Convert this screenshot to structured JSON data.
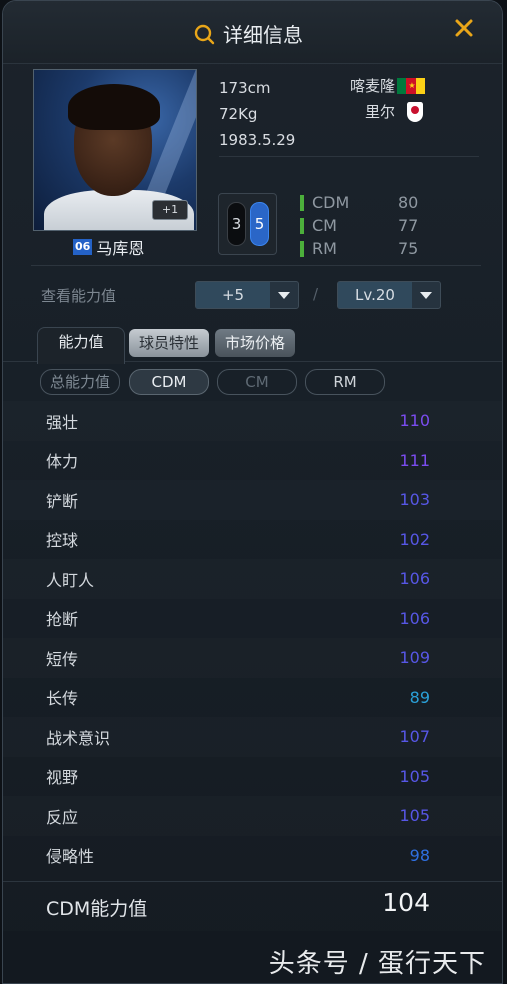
{
  "header": {
    "title": "详细信息",
    "search_icon": "search-icon",
    "close_icon": "close-icon"
  },
  "player": {
    "season": "06",
    "name": "马库恩",
    "plus_badge": "+1",
    "height": "173cm",
    "weight": "72Kg",
    "birth": "1983.5.29",
    "nation": "喀麦隆",
    "club": "里尔",
    "left_foot": "3",
    "right_foot": "5"
  },
  "positions": [
    {
      "name": "CDM",
      "value": "80"
    },
    {
      "name": "CM",
      "value": "77"
    },
    {
      "name": "RM",
      "value": "75"
    }
  ],
  "view": {
    "label": "查看能力值",
    "enhance": "+5",
    "level": "Lv.20",
    "separator": "/"
  },
  "tabs": [
    {
      "label": "能力值"
    },
    {
      "label": "球员特性"
    },
    {
      "label": "市场价格"
    }
  ],
  "filters": [
    {
      "label": "总能力值"
    },
    {
      "label": "CDM"
    },
    {
      "label": "CM"
    },
    {
      "label": "RM"
    }
  ],
  "stats": [
    {
      "name": "强壮",
      "value": "110",
      "color": "#7b4cf0"
    },
    {
      "name": "体力",
      "value": "111",
      "color": "#7b4cf0"
    },
    {
      "name": "铲断",
      "value": "103",
      "color": "#5757e6"
    },
    {
      "name": "控球",
      "value": "102",
      "color": "#5757e6"
    },
    {
      "name": "人盯人",
      "value": "106",
      "color": "#5757e6"
    },
    {
      "name": "抢断",
      "value": "106",
      "color": "#5757e6"
    },
    {
      "name": "短传",
      "value": "109",
      "color": "#5757e6"
    },
    {
      "name": "长传",
      "value": "89",
      "color": "#2aa0d8"
    },
    {
      "name": "战术意识",
      "value": "107",
      "color": "#5757e6"
    },
    {
      "name": "视野",
      "value": "105",
      "color": "#5757e6"
    },
    {
      "name": "反应",
      "value": "105",
      "color": "#5757e6"
    },
    {
      "name": "侵略性",
      "value": "98",
      "color": "#2f6fe0"
    }
  ],
  "overall": {
    "label": "CDM能力值",
    "value": "104"
  },
  "watermark": "头条号 / 蛋行天下",
  "colors": {
    "accent": "#e9a619",
    "active_foot": "#2a66c7",
    "position_bar": "#4caf3b"
  }
}
